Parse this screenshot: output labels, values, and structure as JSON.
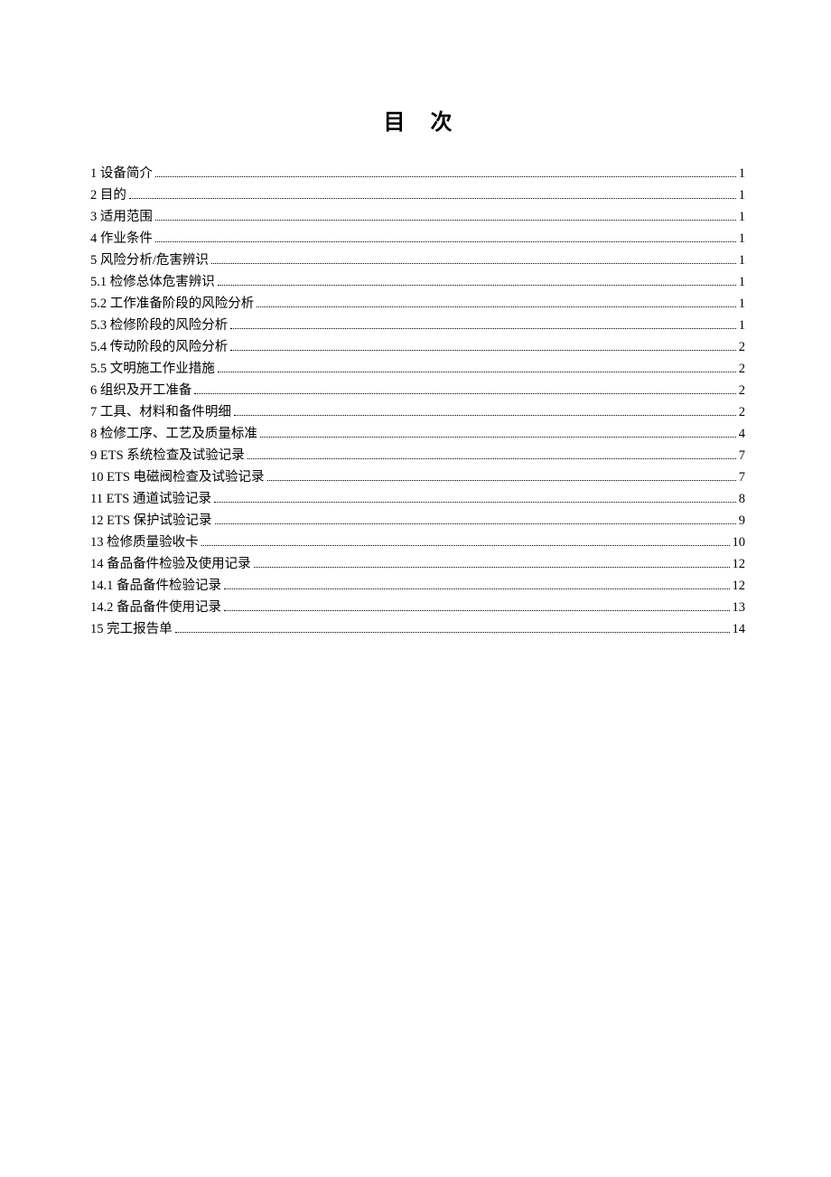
{
  "title": "目次",
  "entries": [
    {
      "label": "1 设备简介",
      "page": "1"
    },
    {
      "label": "2 目的",
      "page": "1"
    },
    {
      "label": "3 适用范围",
      "page": "1"
    },
    {
      "label": "4 作业条件",
      "page": "1"
    },
    {
      "label": "5 风险分析/危害辨识",
      "page": "1"
    },
    {
      "label": "5.1  检修总体危害辨识",
      "page": "1"
    },
    {
      "label": "5.2  工作准备阶段的风险分析",
      "page": "1"
    },
    {
      "label": "5.3  检修阶段的风险分析",
      "page": "1"
    },
    {
      "label": "5.4  传动阶段的风险分析",
      "page": "2"
    },
    {
      "label": "5.5  文明施工作业措施",
      "page": "2"
    },
    {
      "label": "6 组织及开工准备",
      "page": "2"
    },
    {
      "label": "7 工具、材料和备件明细",
      "page": "2"
    },
    {
      "label": "8 检修工序、工艺及质量标准",
      "page": "4"
    },
    {
      "label": "9 ETS 系统检查及试验记录",
      "page": "7"
    },
    {
      "label": "10 ETS 电磁阀检查及试验记录",
      "page": "7"
    },
    {
      "label": "11 ETS 通道试验记录",
      "page": "8"
    },
    {
      "label": "12 ETS 保护试验记录",
      "page": "9"
    },
    {
      "label": "13 检修质量验收卡",
      "page": "10"
    },
    {
      "label": "14 备品备件检验及使用记录",
      "page": "12"
    },
    {
      "label": "14.1 备品备件检验记录",
      "page": "12"
    },
    {
      "label": "14.2 备品备件使用记录",
      "page": "13"
    },
    {
      "label": "15 完工报告单",
      "page": "14"
    }
  ]
}
